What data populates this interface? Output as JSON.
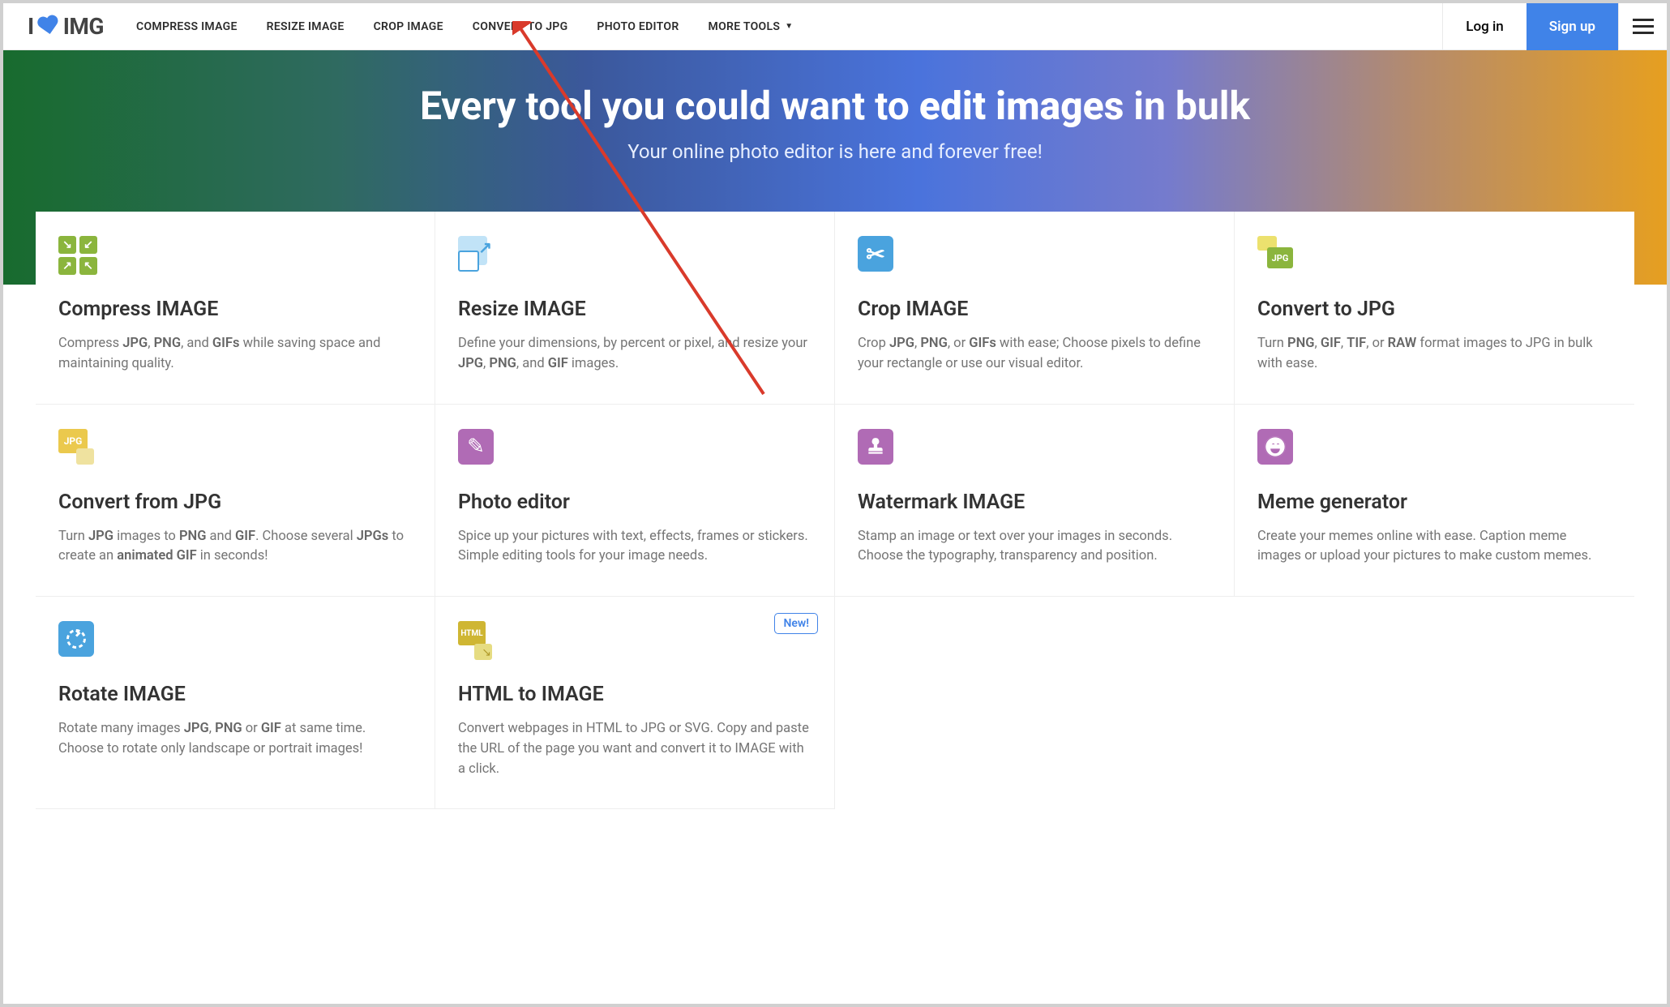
{
  "logo": {
    "prefix": "I",
    "suffix": "IMG"
  },
  "nav": {
    "compress": "COMPRESS IMAGE",
    "resize": "RESIZE IMAGE",
    "crop": "CROP IMAGE",
    "convert": "CONVERT TO JPG",
    "editor": "PHOTO EDITOR",
    "more": "MORE TOOLS"
  },
  "auth": {
    "login": "Log in",
    "signup": "Sign up"
  },
  "hero": {
    "title_a": "Every tool you could want to ",
    "title_b": "edit images",
    "title_c": " in bulk",
    "sub": "Your online photo editor is here and forever free!"
  },
  "tools": {
    "compress": {
      "title": "Compress IMAGE",
      "desc": "Compress <strong>JPG</strong>, <strong>PNG</strong>, and <strong>GIFs</strong> while saving space and maintaining quality."
    },
    "resize": {
      "title": "Resize IMAGE",
      "desc": "Define your dimensions, by percent or pixel, and resize your <strong>JPG</strong>, <strong>PNG</strong>, and <strong>GIF</strong> images."
    },
    "crop": {
      "title": "Crop IMAGE",
      "desc": "Crop <strong>JPG</strong>, <strong>PNG</strong>, or <strong>GIFs</strong> with ease; Choose pixels to define your rectangle or use our visual editor."
    },
    "tojpg": {
      "title": "Convert to JPG",
      "desc": "Turn <strong>PNG</strong>, <strong>GIF</strong>, <strong>TIF</strong>, or <strong>RAW</strong> format images to JPG in bulk with ease."
    },
    "fromjpg": {
      "title": "Convert from JPG",
      "desc": "Turn <strong>JPG</strong> images to <strong>PNG</strong> and <strong>GIF</strong>. Choose several <strong>JPGs</strong> to create an <strong>animated GIF</strong> in seconds!"
    },
    "photo": {
      "title": "Photo editor",
      "desc": "Spice up your pictures with text, effects, frames or stickers. Simple editing tools for your image needs."
    },
    "watermark": {
      "title": "Watermark IMAGE",
      "desc": "Stamp an image or text over your images in seconds. Choose the typography, transparency and position."
    },
    "meme": {
      "title": "Meme generator",
      "desc": "Create your memes online with ease. Caption meme images or upload your pictures to make custom memes."
    },
    "rotate": {
      "title": "Rotate IMAGE",
      "desc": "Rotate many images <strong>JPG</strong>, <strong>PNG</strong> or <strong>GIF</strong> at same time. Choose to rotate only landscape or portrait images!"
    },
    "html": {
      "title": "HTML to IMAGE",
      "desc": "Convert webpages in HTML to JPG or SVG. Copy and paste the URL of the page you want and convert it to IMAGE with a click.",
      "badge": "New!"
    }
  }
}
